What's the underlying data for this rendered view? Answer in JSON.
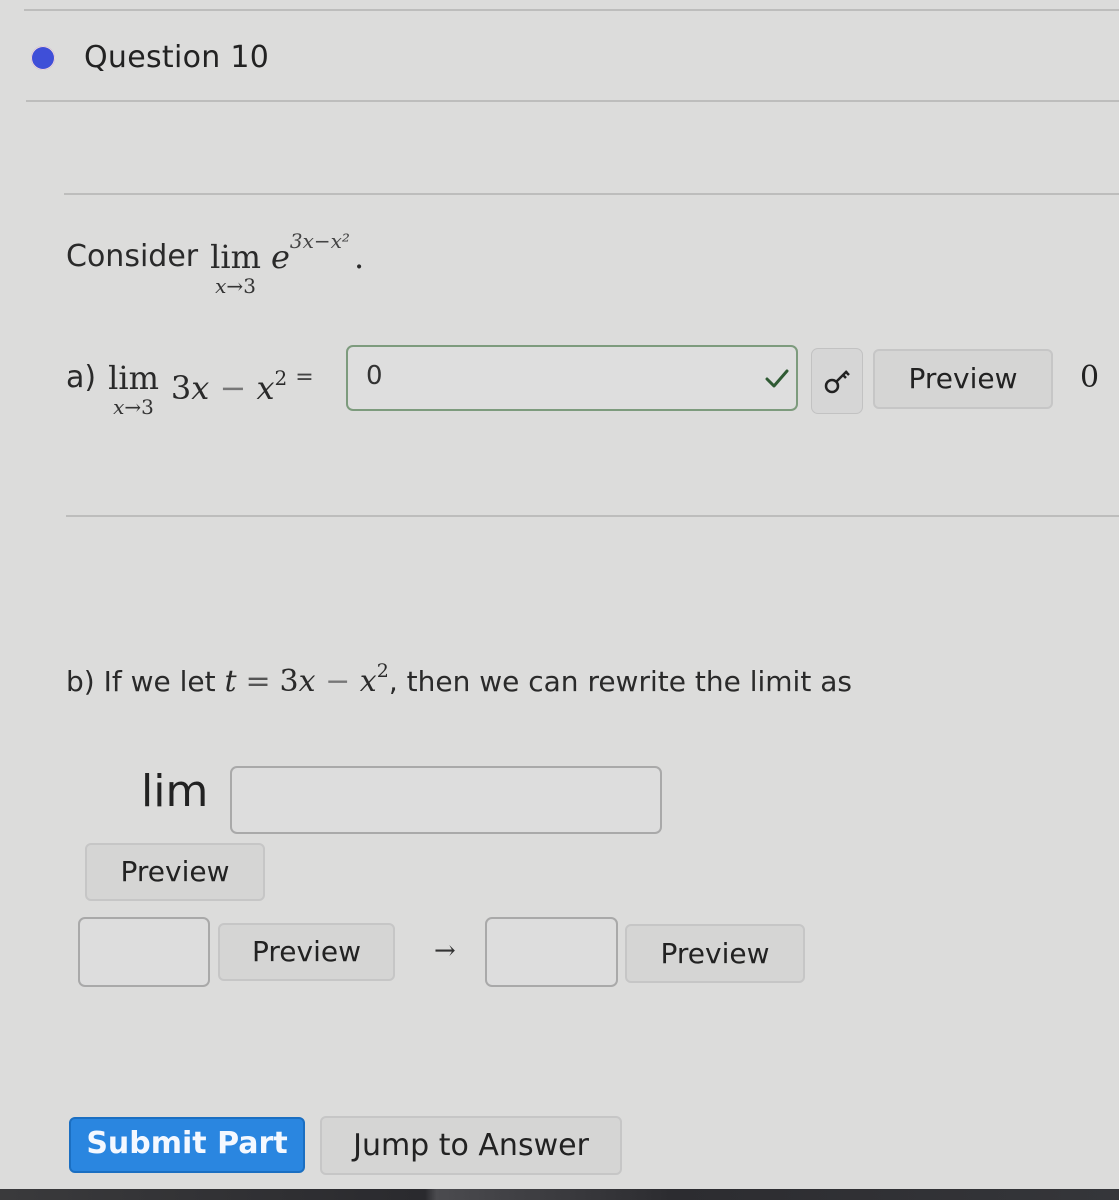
{
  "header": {
    "question_title": "Question 10",
    "status_color": "#3f4fd8"
  },
  "intro": {
    "label": "Consider",
    "lim_word": "lim",
    "lim_sub_var": "x",
    "lim_sub_arrow": "→",
    "lim_sub_value": "3",
    "base": "e",
    "exponent": "3x−x²",
    "end": "."
  },
  "part_a": {
    "letter": "a)",
    "lim_word": "lim",
    "lim_sub_var": "x",
    "lim_sub_arrow": "→",
    "lim_sub_value": "3",
    "expr_coef": "3",
    "expr_var": "x",
    "expr_minus": "−",
    "expr_var2": "x",
    "expr_power": "2",
    "equals": "=",
    "answer_value": "0",
    "answer_status": "correct",
    "preview_label": "Preview",
    "preview_result": "0"
  },
  "part_b": {
    "prefix": "b) If we let",
    "t_var": "t",
    "equals": "=",
    "expr_coef": "3",
    "expr_var": "x",
    "expr_minus": "−",
    "expr_var2": "x",
    "expr_power": "2",
    "suffix": ", then we can rewrite the limit as",
    "lim_label": "lim",
    "lim_input_value": "",
    "preview_label_1": "Preview",
    "lower_input_value": "",
    "preview_label_2": "Preview",
    "arrow": "→",
    "target_input_value": "",
    "preview_label_3": "Preview"
  },
  "actions": {
    "submit_label": "Submit Part",
    "jump_label": "Jump to Answer",
    "submit_color": "#2a86e0"
  }
}
